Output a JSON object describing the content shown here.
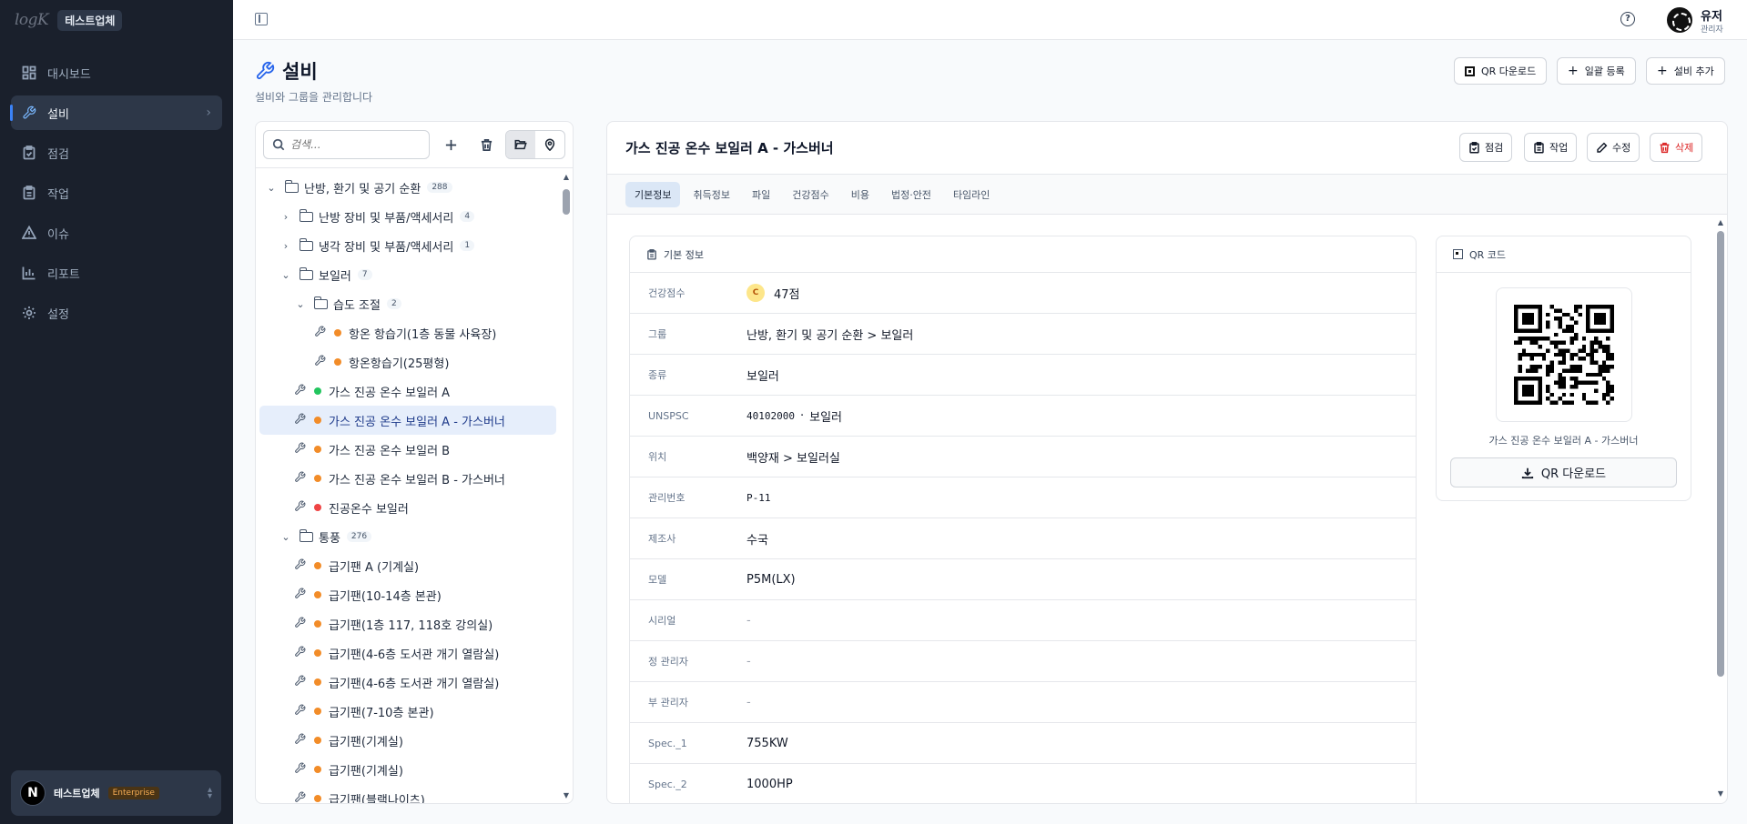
{
  "sidebar": {
    "logo": "logK",
    "org_chip": "테스트업체",
    "nav": [
      {
        "label": "대시보드",
        "icon": "dashboard-icon"
      },
      {
        "label": "설비",
        "icon": "wrench-icon",
        "active": true
      },
      {
        "label": "점검",
        "icon": "clipboard-check-icon"
      },
      {
        "label": "작업",
        "icon": "clipboard-icon"
      },
      {
        "label": "이슈",
        "icon": "warning-icon"
      },
      {
        "label": "리포트",
        "icon": "bar-chart-icon"
      },
      {
        "label": "설정",
        "icon": "gear-icon"
      }
    ],
    "workspace": {
      "avatar": "N",
      "name": "테스트업체",
      "plan": "Enterprise"
    }
  },
  "topbar": {
    "user_name": "유저",
    "user_role": "관리자",
    "help": "?"
  },
  "page": {
    "title": "설비",
    "subtitle": "설비와 그룹을 관리합니다",
    "buttons": {
      "qr_download": "QR 다운로드",
      "bulk_register": "일괄 등록",
      "add_equipment": "설비 추가"
    }
  },
  "tree": {
    "search_placeholder": "검색...",
    "items": [
      {
        "label": "난방, 환기 및 공기 순환",
        "count": "288"
      },
      {
        "label": "난방 장비 및 부품/액세서리",
        "count": "4"
      },
      {
        "label": "냉각 장비 및 부품/액세서리",
        "count": "1"
      },
      {
        "label": "보일러",
        "count": "7"
      },
      {
        "label": "습도 조절",
        "count": "2"
      },
      {
        "label": "항온 항습기(1층 동물 사육장)"
      },
      {
        "label": "항온항습기(25평형)"
      },
      {
        "label": "가스 진공 온수 보일러 A"
      },
      {
        "label": "가스 진공 온수 보일러 A - 가스버너"
      },
      {
        "label": "가스 진공 온수 보일러 B"
      },
      {
        "label": "가스 진공 온수 보일러 B - 가스버너"
      },
      {
        "label": "진공온수 보일러"
      },
      {
        "label": "통풍",
        "count": "276"
      },
      {
        "label": "급기팬 A (기계실)"
      },
      {
        "label": "급기팬(10-14층 본관)"
      },
      {
        "label": "급기팬(1층 117, 118호 강의실)"
      },
      {
        "label": "급기팬(4-6층 도서관 개기 열람실)"
      },
      {
        "label": "급기팬(4-6층 도서관 개기 열람실)"
      },
      {
        "label": "급기팬(7-10층 본관)"
      },
      {
        "label": "급기팬(기계실)"
      },
      {
        "label": "급기팬(기계실)"
      },
      {
        "label": "급기팬(블랙나이츠)"
      }
    ],
    "colors": {
      "orange": "#f28c28",
      "green": "#22c55e",
      "red": "#ef4444"
    }
  },
  "detail": {
    "title": "가스 진공 온수 보일러 A - 가스버너",
    "actions": {
      "inspect": "점검",
      "work": "작업",
      "edit": "수정",
      "delete": "삭제"
    },
    "tabs": [
      "기본정보",
      "취득정보",
      "파일",
      "건강점수",
      "비용",
      "법정·안전",
      "타임라인"
    ],
    "info_title": "기본 정보",
    "rows": {
      "health": {
        "label": "건강점수",
        "grade": "C",
        "value": "47점"
      },
      "group": {
        "label": "그룹",
        "value": "난방, 환기 및 공기 순환 > 보일러"
      },
      "kind": {
        "label": "종류",
        "value": "보일러"
      },
      "unspsc": {
        "label": "UNSPSC",
        "code": "40102000",
        "sep": "·",
        "value": "보일러"
      },
      "location": {
        "label": "위치",
        "value": "백양재 > 보일러실"
      },
      "mgmt_no": {
        "label": "관리번호",
        "value": "P-11"
      },
      "maker": {
        "label": "제조사",
        "value": "수국"
      },
      "model": {
        "label": "모델",
        "value": "P5M(LX)"
      },
      "serial": {
        "label": "시리얼",
        "value": "-"
      },
      "manager": {
        "label": "정 관리자",
        "value": "-"
      },
      "sub_manager": {
        "label": "부 관리자",
        "value": "-"
      },
      "spec1": {
        "label": "Spec._1",
        "value": "755KW"
      },
      "spec2": {
        "label": "Spec._2",
        "value": "1000HP"
      }
    },
    "qr": {
      "title": "QR 코드",
      "caption": "가스 진공 온수 보일러 A - 가스버너",
      "download": "QR 다운로드"
    }
  }
}
